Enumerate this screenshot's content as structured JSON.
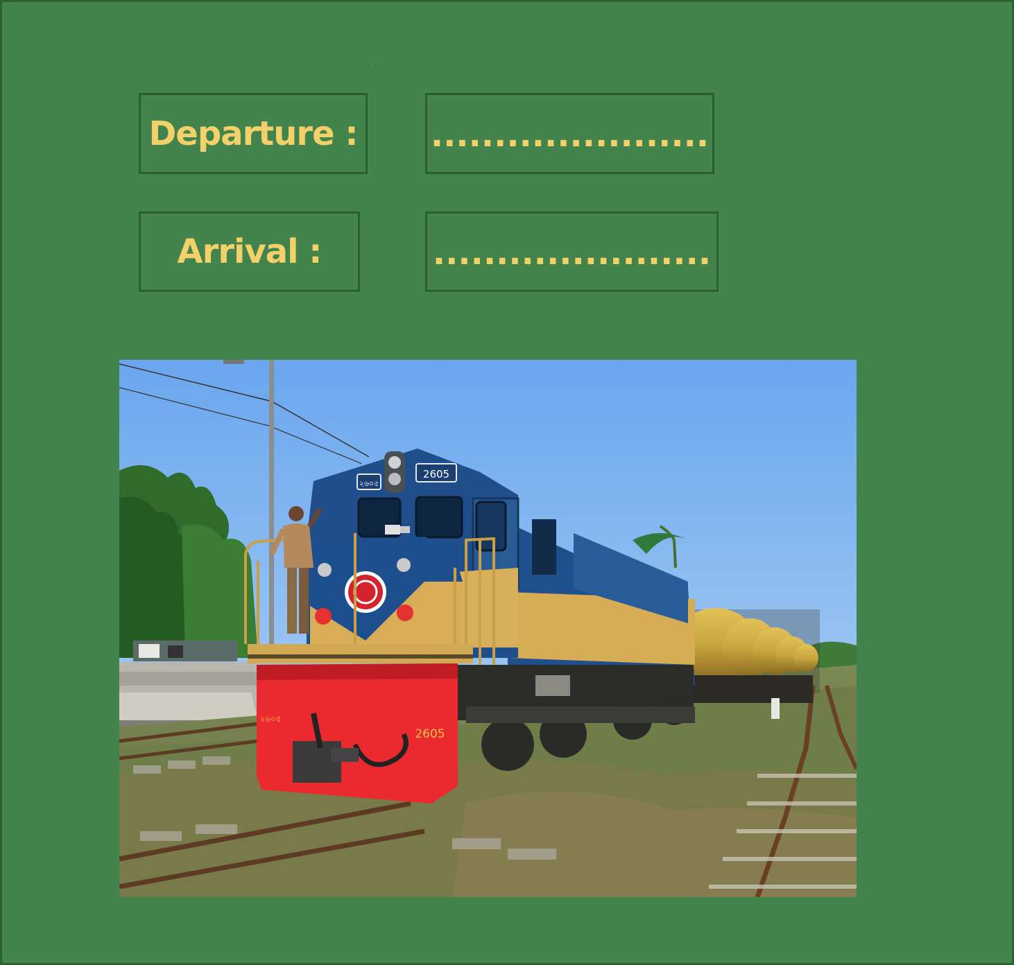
{
  "schedule": {
    "departure_label": "Departure :",
    "departure_value": "......................",
    "arrival_label": "Arrival :",
    "arrival_value": "......................"
  },
  "photo": {
    "locomotive_number": "2605",
    "locomotive_number_bengali": "২৬০৫"
  },
  "colors": {
    "background": "#43844c",
    "box_border": "#2a5e31",
    "text": "#f4d06b"
  }
}
